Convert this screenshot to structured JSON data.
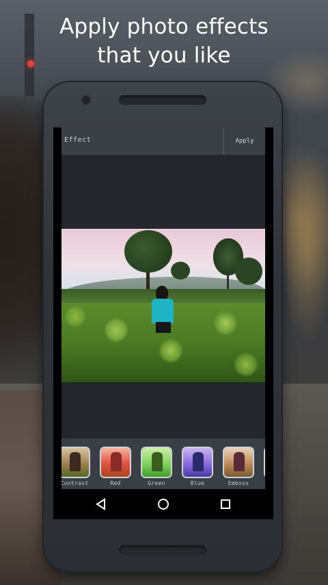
{
  "headline": {
    "line1": "Apply photo effects",
    "line2": "that you like"
  },
  "app": {
    "title": "Effect",
    "apply_label": "Apply"
  },
  "filters": [
    {
      "label": "Contrast",
      "tint": "#b07a3a"
    },
    {
      "label": "Red",
      "tint": "#e0523f"
    },
    {
      "label": "Green",
      "tint": "#5fc24a"
    },
    {
      "label": "Blue",
      "tint": "#7a55d6"
    },
    {
      "label": "Emboss",
      "tint": "#c08a5a"
    }
  ],
  "navbar": {
    "back": "back-icon",
    "home": "home-icon",
    "recents": "recents-icon"
  },
  "colors": {
    "toolbar": "#3b4047",
    "canvas": "#23262b",
    "strip": "#3a3f46",
    "text": "#ffffff"
  }
}
